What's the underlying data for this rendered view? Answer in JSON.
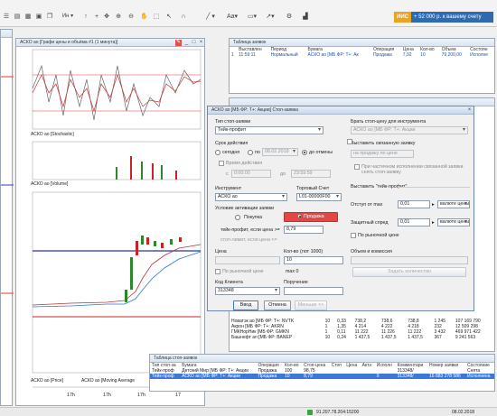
{
  "toolbar": {
    "menu_label": "Ин",
    "font_label": "Aa",
    "promo_tag": "ИИС",
    "promo_text": "+ 52 000 р. к вашему счету"
  },
  "chart_window": {
    "title": "АСКО ао [Графи цены и объёма #1 (1 минута)]",
    "stoch_legend": "АСКО ао [Stochastic]",
    "volume_legend": "АСКО ао [Volume]",
    "price_legend": "АСКО ао [Price]",
    "ma_legend": "АСКО ао [Moving Average",
    "time_labels": [
      "17h",
      "17h",
      "17h",
      "17"
    ]
  },
  "deals_window": {
    "title": "Таблица заявок",
    "headers": [
      "Выставлен",
      "Период",
      "Бумага",
      "Операция",
      "Цена",
      "Кол-во",
      "Объем",
      "Состоян"
    ],
    "row": [
      "11:59:11",
      "Нормальный",
      "АСКО ао [МБ ФР: Т+: Ак",
      "Продажа",
      "7,92",
      "10",
      "79 200,00",
      "Исполне"
    ]
  },
  "quotes_window": {
    "rows": [
      [
        "Новатэк ао [МБ ФР: Т+: NVTK",
        "10",
        "0,33",
        "738,2",
        "738,6",
        "738,8",
        "1 245",
        "107 169 790"
      ],
      [
        "Акрон [МБ ФР: Т+: AKRN",
        "1",
        "1,35",
        "4 214",
        "4 222",
        "4 218",
        "232",
        "12 509 298"
      ],
      [
        "ГМКНорНик [МБ ФР: GMKN",
        "1",
        "0,11",
        "11 222",
        "11 226",
        "11 222",
        "3 432",
        "469 971 422"
      ],
      [
        "Башнефт ап [МБ ФР: BANEP",
        "10",
        "0,24",
        "1 437,5",
        "1 437,5",
        "1 437,5",
        "367",
        "9 241 563"
      ]
    ]
  },
  "stop_table": {
    "title": "Таблица стоп-заявок",
    "headers": [
      "Тип стоп-за",
      "Бумага",
      "Операция",
      "Кол-во",
      "Стоп-цена",
      "Стоп",
      "Цена",
      "Акт.к",
      "Исполн",
      "Комментари",
      "Номер заявки",
      "Состояние"
    ],
    "rows": [
      [
        "Тейк-проф",
        "Детский Мир [МБ ФР: Т+: Акции",
        "Продажа",
        "100",
        "98,75",
        "",
        "",
        "",
        "",
        "313348/",
        "",
        "Снята"
      ],
      [
        "Тейк-проф",
        "АСКО ао [МБ ФР: Т+: Акции",
        "Продажа",
        "10",
        "8,79",
        "",
        "",
        "",
        "0",
        "313348/",
        "16 883 278 586",
        "Исполнена"
      ]
    ]
  },
  "dialog": {
    "title": "АСКО ао [МБ ФР: Т+: Акции] Стоп-заявка",
    "type_label": "Тип стоп-заявки",
    "type_value": "Тейк-профит",
    "validity_label": "Срок действия",
    "today_label": "сегодня",
    "until_label": "по",
    "until_date": "08.02.2018",
    "until_cancel_label": "до отмены",
    "time_label": "Время действия",
    "time_from_label": "с",
    "time_from": "0:00:00",
    "time_to_label": "до",
    "time_to": "23:59:59",
    "instrument_label": "Инструмент",
    "instrument_value": "АСКО ао",
    "account_label": "Торговый Счет",
    "account_value": "L01-00000F00",
    "activation_label": "Условие активации заявки",
    "buy_label": "Покупка",
    "sell_label": "Продажа",
    "takeprofit_label": "тейк-профит, если цена >=",
    "takeprofit_value": "8,79",
    "stoplimit_label": "стоп-лимит, если цена <=",
    "price_label": "Цена",
    "qty_label": "Кол-во (лот 1000)",
    "qty_value": "10",
    "market_price_label": "По рыночной цене",
    "max_label": "max 0",
    "client_label": "Код Клиента",
    "client_value": "313348",
    "comment_label": "Поручение",
    "ok_label": "Ввод",
    "cancel_label": "Отмена",
    "more_label": "Меньше <<",
    "take_price_label": "Брать стоп-цену для инструмента",
    "take_price_value": "АСКО ао [МБ ФР: Т+: Акции",
    "linked_label": "Выставить связанную заявку",
    "linked_price_label": "на продажу по цене",
    "partial_label": "При частичном исполнении связанной заявки снять стоп-заявку",
    "tp_section_label": "Выставить \"тейк-профит\"",
    "offset_label": "Отступ от max",
    "offset_value": "0,01",
    "offset_unit": "валюте цены",
    "spread_label": "Защитный спред",
    "spread_value": "0,01",
    "spread_unit": "валюте цены",
    "market_label": "По рыночной цене",
    "volume_label": "Объем и комиссия",
    "calc_button": "Задать количество"
  },
  "status_bar": {
    "ip": "91.207.78.204:15200",
    "date": "08.02.2018"
  }
}
